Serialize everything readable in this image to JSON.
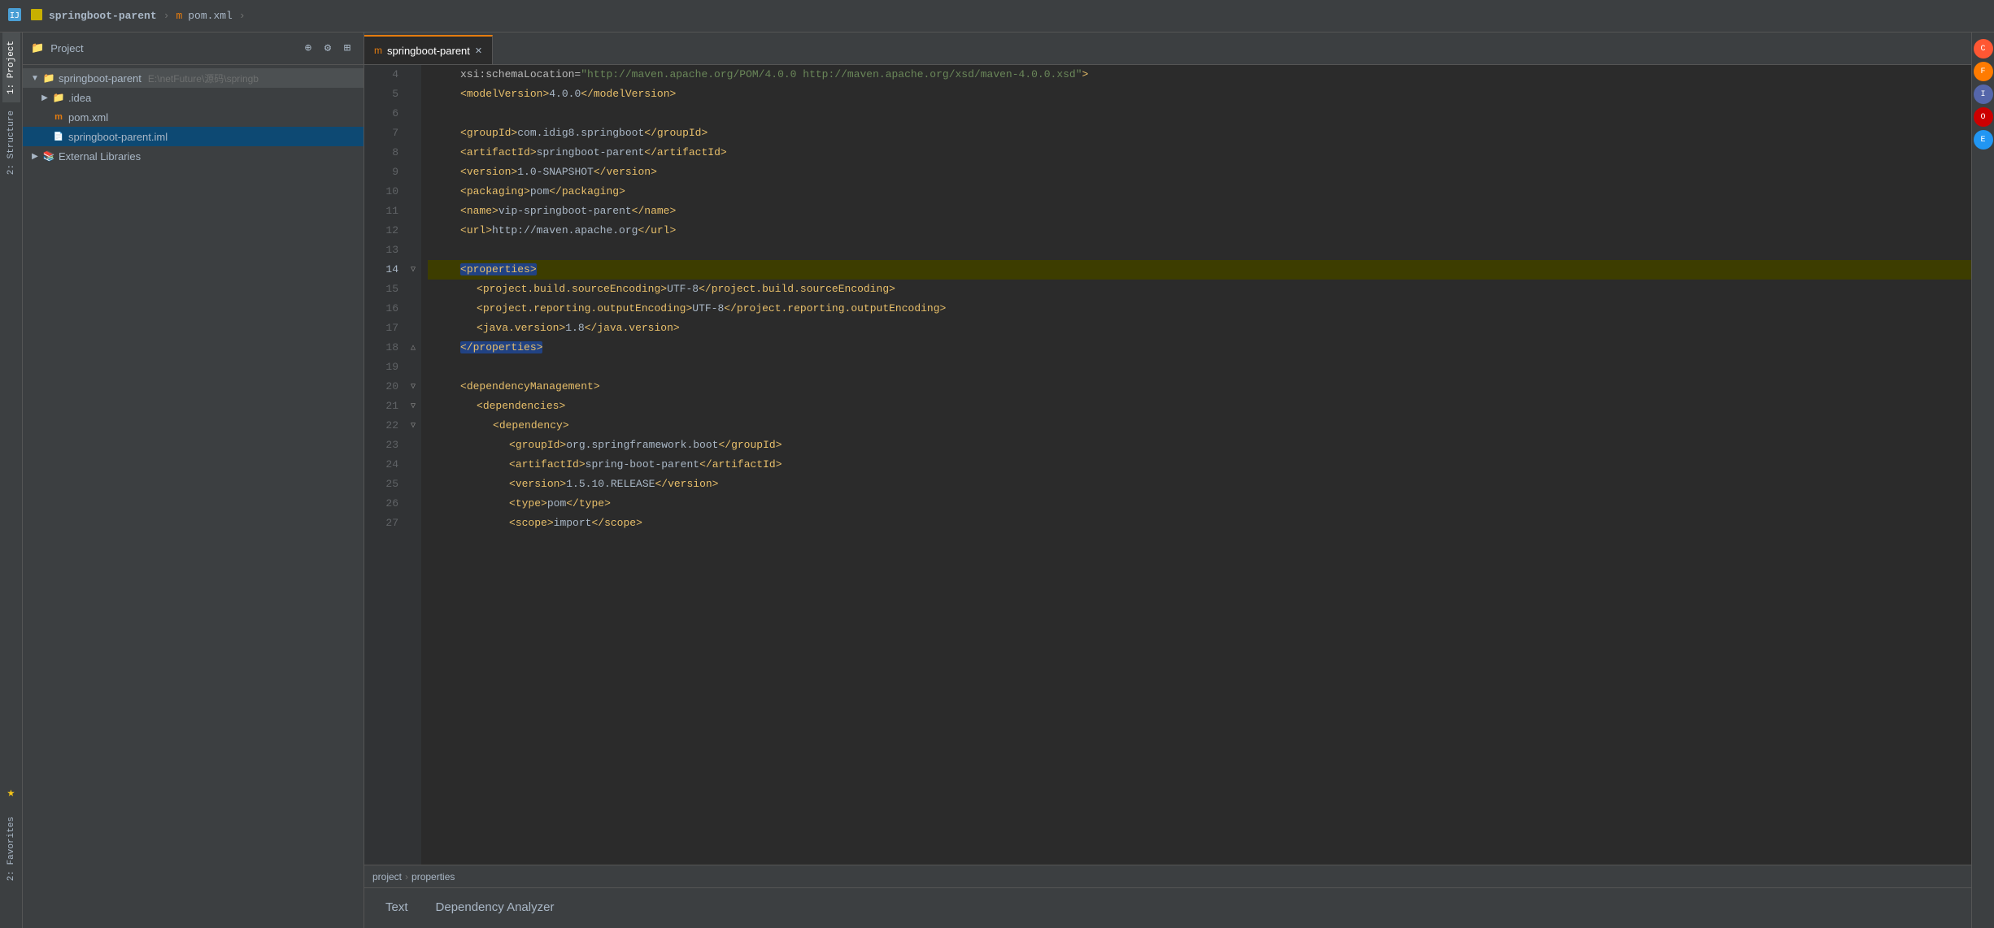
{
  "titleBar": {
    "project": "springboot-parent",
    "separator1": ">",
    "pom": "m pom.xml",
    "separator2": ">"
  },
  "projectPanel": {
    "title": "Project",
    "root": {
      "label": "springboot-parent",
      "path": "E:\\netFuture\\源码\\springb",
      "expanded": true
    },
    "items": [
      {
        "id": "idea",
        "label": ".idea",
        "indent": 1,
        "type": "folder",
        "arrow": "▶"
      },
      {
        "id": "pom",
        "label": "pom.xml",
        "indent": 1,
        "type": "pom",
        "arrow": ""
      },
      {
        "id": "iml",
        "label": "springboot-parent.iml",
        "indent": 1,
        "type": "iml",
        "arrow": ""
      },
      {
        "id": "ext-libs",
        "label": "External Libraries",
        "indent": 0,
        "type": "lib",
        "arrow": "▶"
      }
    ]
  },
  "editorTab": {
    "label": "springboot-parent",
    "icon": "m",
    "closable": true
  },
  "codeLines": [
    {
      "num": 4,
      "indent": 2,
      "content": "xsi:schemaLocation=\"http://maven.apache.org/POM/4.0.0 http://maven.apache.org/xsd/maven-4.0.0.xsd\">",
      "highlight": false
    },
    {
      "num": 5,
      "indent": 2,
      "content": "<modelVersion>4.0.0</modelVersion>",
      "highlight": false
    },
    {
      "num": 6,
      "indent": 0,
      "content": "",
      "highlight": false
    },
    {
      "num": 7,
      "indent": 2,
      "content": "<groupId>com.idig8.springboot</groupId>",
      "highlight": false
    },
    {
      "num": 8,
      "indent": 2,
      "content": "<artifactId>springboot-parent</artifactId>",
      "highlight": false
    },
    {
      "num": 9,
      "indent": 2,
      "content": "<version>1.0-SNAPSHOT</version>",
      "highlight": false
    },
    {
      "num": 10,
      "indent": 2,
      "content": "<packaging>pom</packaging>",
      "highlight": false
    },
    {
      "num": 11,
      "indent": 2,
      "content": "<name>vip-springboot-parent</name>",
      "highlight": false
    },
    {
      "num": 12,
      "indent": 2,
      "content": "<url>http://maven.apache.org</url>",
      "highlight": false
    },
    {
      "num": 13,
      "indent": 0,
      "content": "",
      "highlight": false
    },
    {
      "num": 14,
      "indent": 2,
      "content": "<properties>",
      "highlight": true,
      "selected": true
    },
    {
      "num": 15,
      "indent": 3,
      "content": "<project.build.sourceEncoding>UTF-8</project.build.sourceEncoding>",
      "highlight": false
    },
    {
      "num": 16,
      "indent": 3,
      "content": "<project.reporting.outputEncoding>UTF-8</project.reporting.outputEncoding>",
      "highlight": false
    },
    {
      "num": 17,
      "indent": 3,
      "content": "<java.version>1.8</java.version>",
      "highlight": false
    },
    {
      "num": 18,
      "indent": 2,
      "content": "</properties>",
      "highlight": false,
      "closeSelected": true
    },
    {
      "num": 19,
      "indent": 0,
      "content": "",
      "highlight": false
    },
    {
      "num": 20,
      "indent": 2,
      "content": "<dependencyManagement>",
      "highlight": false
    },
    {
      "num": 21,
      "indent": 3,
      "content": "<dependencies>",
      "highlight": false
    },
    {
      "num": 22,
      "indent": 4,
      "content": "<dependency>",
      "highlight": false
    },
    {
      "num": 23,
      "indent": 5,
      "content": "<groupId>org.springframework.boot</groupId>",
      "highlight": false
    },
    {
      "num": 24,
      "indent": 5,
      "content": "<artifactId>spring-boot-parent</artifactId>",
      "highlight": false
    },
    {
      "num": 25,
      "indent": 5,
      "content": "<version>1.5.10.RELEASE</version>",
      "highlight": false
    },
    {
      "num": 26,
      "indent": 5,
      "content": "<type>pom</type>",
      "highlight": false
    },
    {
      "num": 27,
      "indent": 5,
      "content": "<scope>import</scope>",
      "highlight": false
    }
  ],
  "statusBar": {
    "breadcrumb": [
      "project",
      ">",
      "properties"
    ]
  },
  "bottomTabs": [
    {
      "id": "text",
      "label": "Text",
      "active": false
    },
    {
      "id": "dependency",
      "label": "Dependency Analyzer",
      "active": false
    }
  ],
  "sidebarTabs": [
    {
      "id": "project",
      "label": "1: Project"
    },
    {
      "id": "structure",
      "label": "2: Structure"
    },
    {
      "id": "favorites",
      "label": "2: Favorites"
    }
  ],
  "colors": {
    "background": "#2b2b2b",
    "panel": "#3c3f41",
    "activeTab": "#2b2b2b",
    "inactiveTab": "#4e5254",
    "lineHighlight": "#3d3d00",
    "selectedBg": "#214283"
  }
}
